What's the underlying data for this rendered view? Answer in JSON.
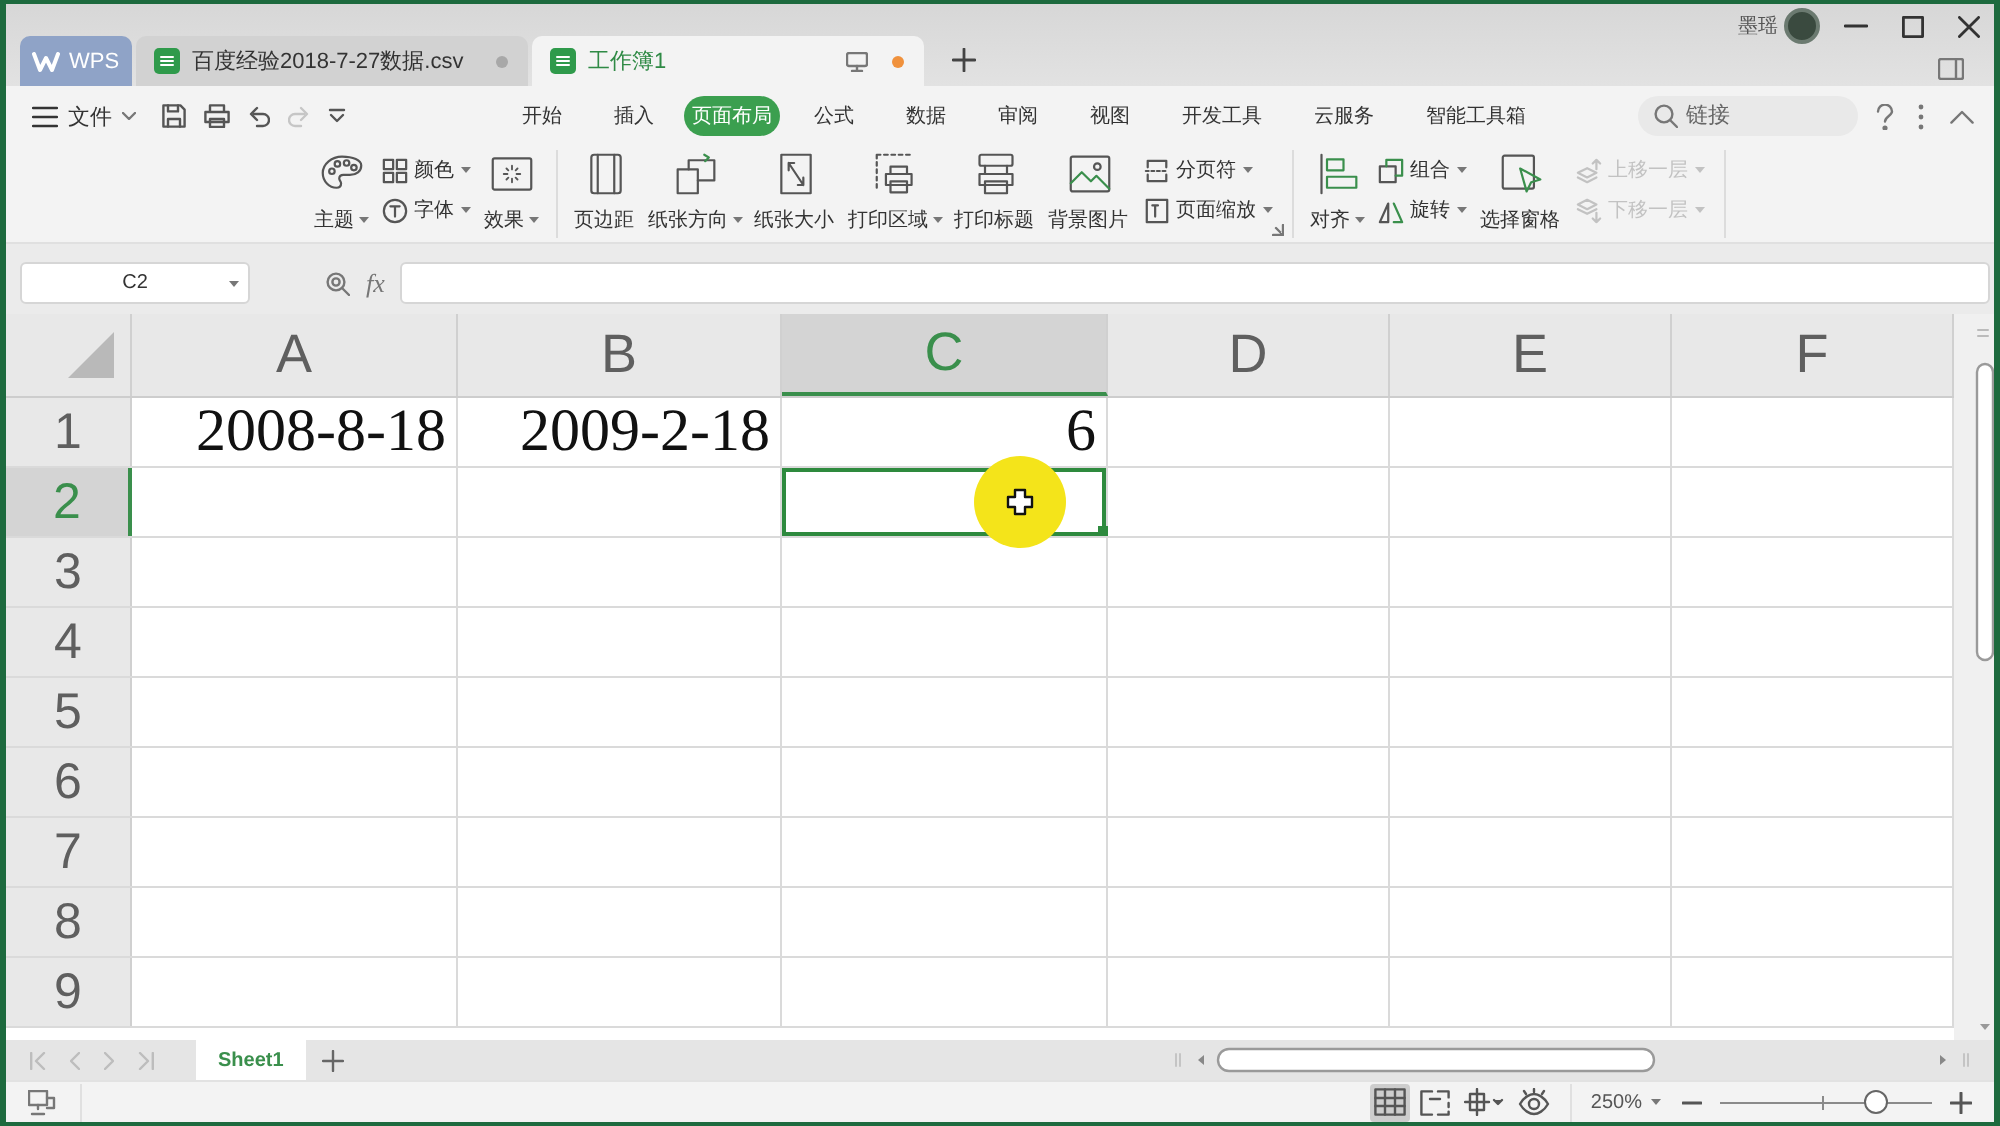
{
  "window": {
    "user_name": "墨瑶"
  },
  "home_tab": {
    "label": "WPS"
  },
  "document_tabs": [
    {
      "label": "百度经验2018-7-27数据.csv",
      "selected": false,
      "modified": false
    },
    {
      "label": "工作簿1",
      "selected": true,
      "modified": true
    }
  ],
  "quick_access": {
    "file_label": "文件",
    "tools": [
      {
        "kind": "save",
        "disabled": false
      },
      {
        "kind": "print",
        "disabled": false
      },
      {
        "kind": "undo",
        "disabled": false
      },
      {
        "kind": "redo",
        "disabled": true
      },
      {
        "kind": "customize",
        "disabled": false
      }
    ]
  },
  "menu_tabs": [
    {
      "label": "开始",
      "selected": false
    },
    {
      "label": "插入",
      "selected": false
    },
    {
      "label": "页面布局",
      "selected": true
    },
    {
      "label": "公式",
      "selected": false
    },
    {
      "label": "数据",
      "selected": false
    },
    {
      "label": "审阅",
      "selected": false
    },
    {
      "label": "视图",
      "selected": false
    },
    {
      "label": "开发工具",
      "selected": false
    },
    {
      "label": "云服务",
      "selected": false
    },
    {
      "label": "智能工具箱",
      "selected": false
    }
  ],
  "search": {
    "placeholder": "链接"
  },
  "ribbon": [
    {
      "launcher": false,
      "columns": [
        {
          "kind": "large",
          "label": "主题",
          "dropdown": true,
          "disabled": false
        },
        {
          "kind": "stack",
          "items": [
            {
              "label": "颜色",
              "dropdown": true,
              "disabled": false
            },
            {
              "label": "字体",
              "dropdown": true,
              "disabled": false
            }
          ]
        },
        {
          "kind": "large",
          "label": "效果",
          "dropdown": true,
          "disabled": false
        }
      ]
    },
    {
      "launcher": true,
      "columns": [
        {
          "kind": "large",
          "label": "页边距",
          "dropdown": false,
          "disabled": false
        },
        {
          "kind": "large",
          "label": "纸张方向",
          "dropdown": true,
          "disabled": false
        },
        {
          "kind": "large",
          "label": "纸张大小",
          "dropdown": false,
          "disabled": false
        },
        {
          "kind": "large",
          "label": "打印区域",
          "dropdown": true,
          "disabled": false
        },
        {
          "kind": "large",
          "label": "打印标题",
          "dropdown": false,
          "disabled": false
        },
        {
          "kind": "large",
          "label": "背景图片",
          "dropdown": false,
          "disabled": false
        },
        {
          "kind": "stack",
          "items": [
            {
              "label": "分页符",
              "dropdown": true,
              "disabled": false
            },
            {
              "label": "页面缩放",
              "dropdown": true,
              "disabled": false
            }
          ]
        }
      ]
    },
    {
      "launcher": false,
      "columns": [
        {
          "kind": "large",
          "label": "对齐",
          "dropdown": true,
          "disabled": false
        },
        {
          "kind": "stack",
          "items": [
            {
              "label": "组合",
              "dropdown": true,
              "disabled": false
            },
            {
              "label": "旋转",
              "dropdown": true,
              "disabled": false
            }
          ]
        },
        {
          "kind": "large",
          "label": "选择窗格",
          "dropdown": false,
          "disabled": false
        },
        {
          "kind": "stack",
          "items": [
            {
              "label": "上移一层",
              "dropdown": true,
              "disabled": true
            },
            {
              "label": "下移一层",
              "dropdown": true,
              "disabled": true
            }
          ]
        }
      ]
    }
  ],
  "name_box": {
    "value": "C2"
  },
  "formula_bar": {
    "function_label": "fx"
  },
  "columns": [
    {
      "label": "A",
      "selected": false
    },
    {
      "label": "B",
      "selected": false
    },
    {
      "label": "C",
      "selected": true
    },
    {
      "label": "D",
      "selected": false
    },
    {
      "label": "E",
      "selected": false
    },
    {
      "label": "F",
      "selected": false
    }
  ],
  "rows": [
    {
      "label": "1",
      "selected": false,
      "cells": [
        "2008-8-18",
        "2009-2-18",
        "6"
      ]
    },
    {
      "label": "2",
      "selected": true
    },
    {
      "label": "3",
      "selected": false
    },
    {
      "label": "4",
      "selected": false
    },
    {
      "label": "5",
      "selected": false
    },
    {
      "label": "6",
      "selected": false
    },
    {
      "label": "7",
      "selected": false
    },
    {
      "label": "8",
      "selected": false
    },
    {
      "label": "9",
      "selected": false
    }
  ],
  "sheet_tabs": [
    {
      "label": "Sheet1",
      "selected": true
    }
  ],
  "status_bar": {
    "views": [
      {
        "kind": "normal",
        "selected": true
      },
      {
        "kind": "pagebreak",
        "selected": false
      },
      {
        "kind": "reading",
        "selected": false
      },
      {
        "kind": "eye",
        "selected": false
      }
    ],
    "zoom": {
      "label": "250%",
      "level": 0.74
    }
  }
}
